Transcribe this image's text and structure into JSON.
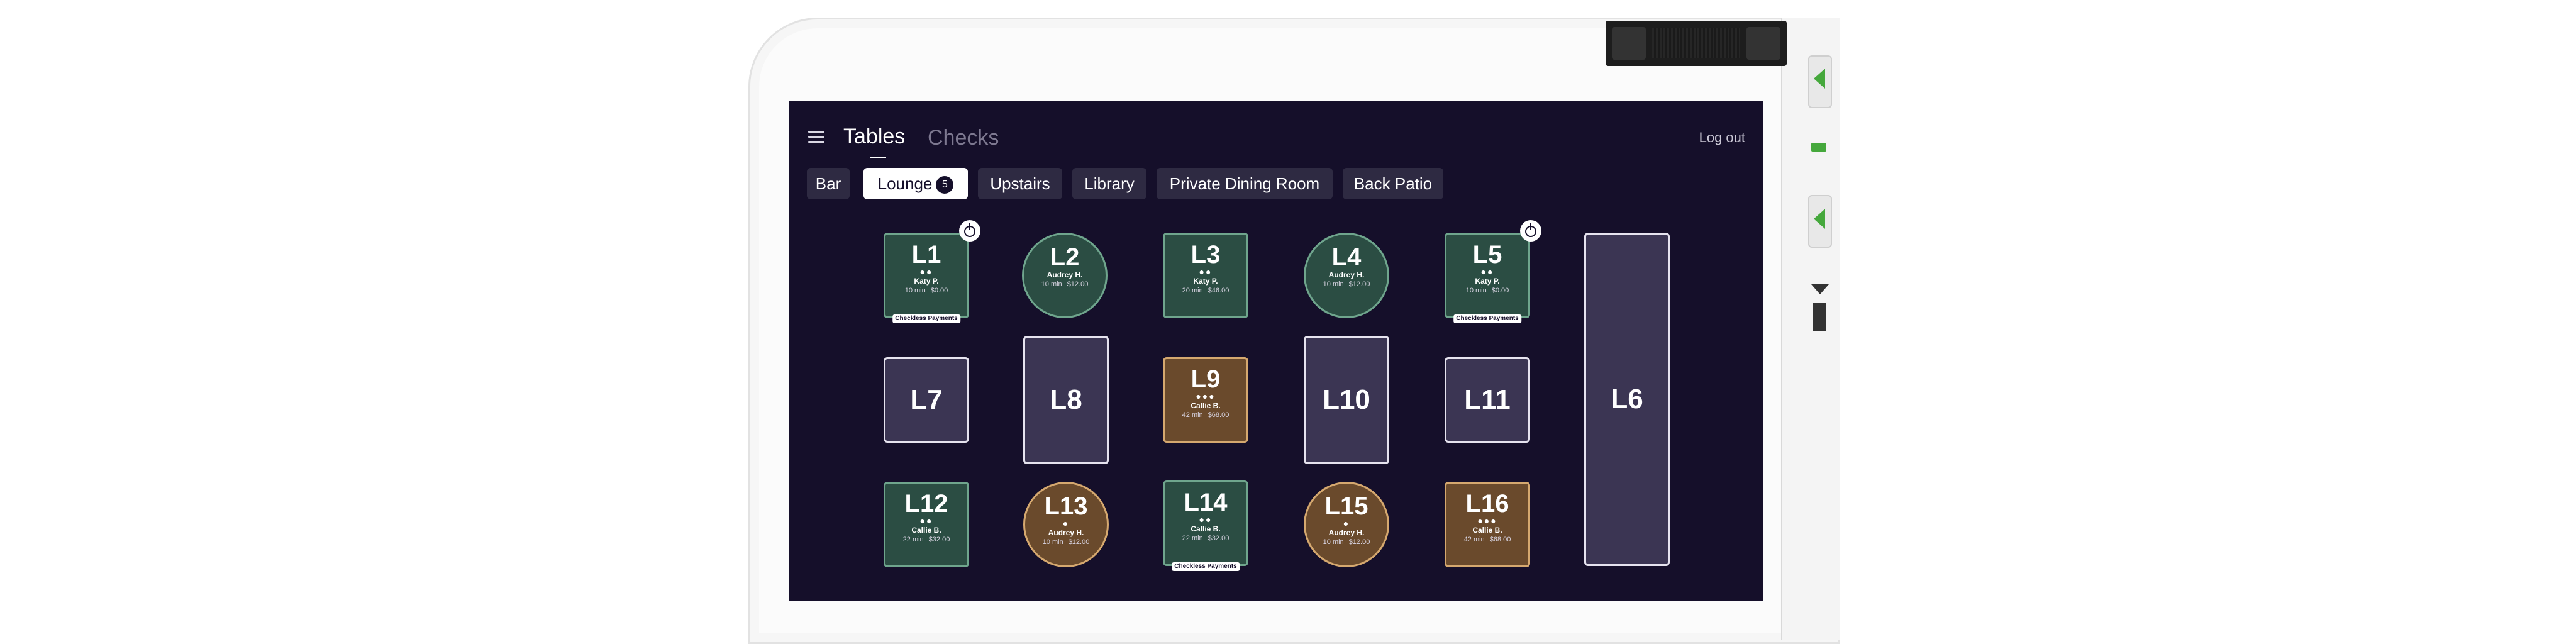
{
  "header": {
    "tabs": [
      "Tables",
      "Checks"
    ],
    "logout_label": "Log out"
  },
  "areas": [
    {
      "label": "Bar"
    },
    {
      "label": "Lounge",
      "badge": "5",
      "active": true
    },
    {
      "label": "Upstairs"
    },
    {
      "label": "Library"
    },
    {
      "label": "Private Dining Room"
    },
    {
      "label": "Back Patio"
    }
  ],
  "tables": [
    {
      "name": "L1",
      "dots": "●●",
      "server": "Katy P.",
      "time": "10 min",
      "amount": "$0.00",
      "checkless": "Checkless Payments",
      "timer": true,
      "status": "green"
    },
    {
      "name": "L2",
      "dots": "",
      "server": "Audrey H.",
      "time": "10 min",
      "amount": "$12.00",
      "status": "green"
    },
    {
      "name": "L3",
      "dots": "●●",
      "server": "Katy P.",
      "time": "20 min",
      "amount": "$46.00",
      "status": "green"
    },
    {
      "name": "L4",
      "dots": "",
      "server": "Audrey H.",
      "time": "10 min",
      "amount": "$12.00",
      "status": "green"
    },
    {
      "name": "L5",
      "dots": "●●",
      "server": "Katy P.",
      "time": "10 min",
      "amount": "$0.00",
      "checkless": "Checkless Payments",
      "timer": true,
      "status": "green"
    },
    {
      "name": "L6",
      "status": "empty"
    },
    {
      "name": "L7",
      "status": "empty"
    },
    {
      "name": "L8",
      "status": "empty"
    },
    {
      "name": "L9",
      "dots": "●●●",
      "server": "Callie B.",
      "time": "42 min",
      "amount": "$68.00",
      "status": "brown"
    },
    {
      "name": "L10",
      "status": "empty"
    },
    {
      "name": "L11",
      "status": "empty"
    },
    {
      "name": "L12",
      "dots": "●●",
      "server": "Callie B.",
      "time": "22 min",
      "amount": "$32.00",
      "status": "green"
    },
    {
      "name": "L13",
      "dots": "●",
      "server": "Audrey H.",
      "time": "10 min",
      "amount": "$12.00",
      "status": "brown"
    },
    {
      "name": "L14",
      "dots": "●●",
      "server": "Callie B.",
      "time": "22 min",
      "amount": "$32.00",
      "checkless": "Checkless Payments",
      "status": "green"
    },
    {
      "name": "L15",
      "dots": "●",
      "server": "Audrey H.",
      "time": "10 min",
      "amount": "$12.00",
      "status": "brown"
    },
    {
      "name": "L16",
      "dots": "●●●",
      "server": "Callie B.",
      "time": "42 min",
      "amount": "$68.00",
      "status": "brown"
    }
  ],
  "colors": {
    "background": "#150f2a",
    "table_empty": "#3b3553",
    "table_green": "#2b4d43",
    "table_brown": "#6a4a2c",
    "accent_green": "#45a83c"
  }
}
